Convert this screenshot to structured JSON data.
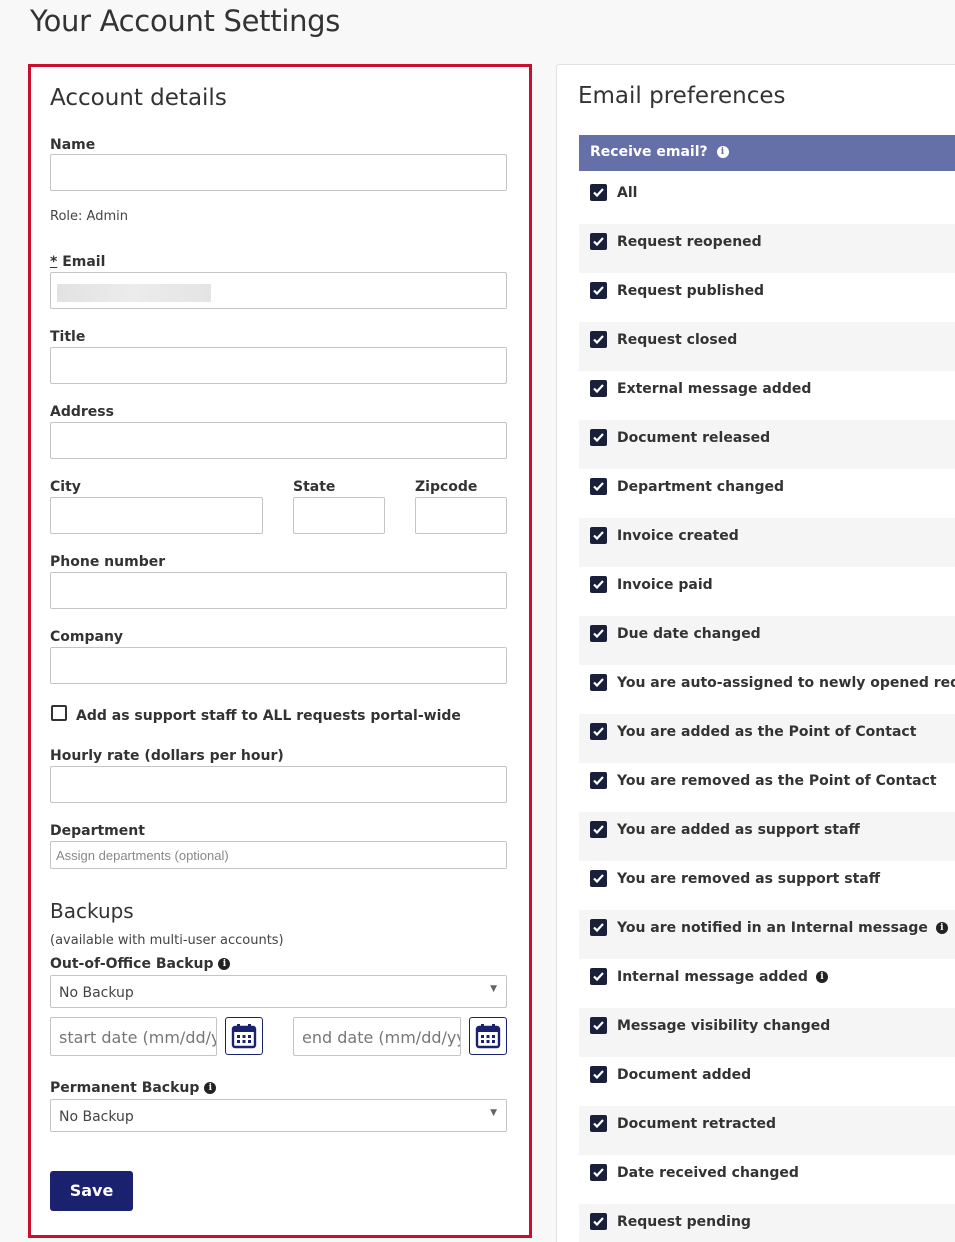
{
  "page": {
    "title": "Your Account Settings"
  },
  "account": {
    "heading": "Account details",
    "name_label": "Name",
    "role_text": "Role: Admin",
    "email_required_mark": "*",
    "email_label": "Email",
    "title_label": "Title",
    "address_label": "Address",
    "city_label": "City",
    "state_label": "State",
    "zipcode_label": "Zipcode",
    "phone_label": "Phone number",
    "company_label": "Company",
    "support_staff_label": "Add as support staff to ALL requests portal-wide",
    "support_staff_checked": false,
    "hourly_rate_label": "Hourly rate (dollars per hour)",
    "department_label": "Department",
    "department_placeholder": "Assign departments (optional)",
    "backups_heading": "Backups",
    "backups_note": "(available with multi-user accounts)",
    "ooo_backup_label": "Out-of-Office Backup",
    "ooo_backup_value": "No Backup",
    "start_date_placeholder": "start date (mm/dd/y",
    "end_date_placeholder": "end date (mm/dd/yy",
    "permanent_backup_label": "Permanent Backup",
    "permanent_backup_value": "No Backup",
    "save_label": "Save"
  },
  "email": {
    "heading": "Email preferences",
    "header_label": "Receive email?",
    "accent_color": "#6670a8",
    "prefs": [
      {
        "label": "All",
        "checked": true
      },
      {
        "label": "Request reopened",
        "checked": true
      },
      {
        "label": "Request published",
        "checked": true
      },
      {
        "label": "Request closed",
        "checked": true
      },
      {
        "label": "External message added",
        "checked": true
      },
      {
        "label": "Document released",
        "checked": true
      },
      {
        "label": "Department changed",
        "checked": true
      },
      {
        "label": "Invoice created",
        "checked": true
      },
      {
        "label": "Invoice paid",
        "checked": true
      },
      {
        "label": "Due date changed",
        "checked": true
      },
      {
        "label": "You are auto-assigned to newly opened request",
        "checked": true
      },
      {
        "label": "You are added as the Point of Contact",
        "checked": true
      },
      {
        "label": "You are removed as the Point of Contact",
        "checked": true
      },
      {
        "label": "You are added as support staff",
        "checked": true
      },
      {
        "label": "You are removed as support staff",
        "checked": true
      },
      {
        "label": "You are notified in an Internal message",
        "checked": true,
        "info": true
      },
      {
        "label": "Internal message added",
        "checked": true,
        "info": true
      },
      {
        "label": "Message visibility changed",
        "checked": true
      },
      {
        "label": "Document added",
        "checked": true
      },
      {
        "label": "Document retracted",
        "checked": true
      },
      {
        "label": "Date received changed",
        "checked": true
      },
      {
        "label": "Request pending",
        "checked": true
      }
    ]
  },
  "colors": {
    "primary": "#1a2270",
    "highlight_border": "#c8102e"
  }
}
